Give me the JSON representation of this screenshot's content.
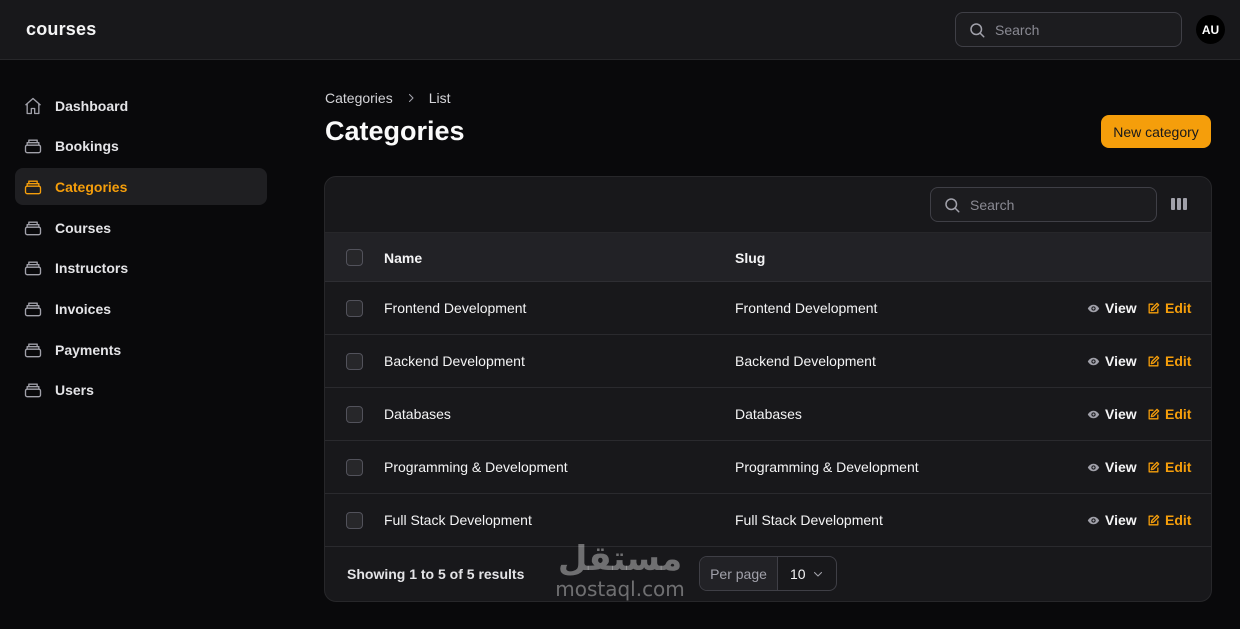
{
  "app": {
    "brand": "courses",
    "avatar_initials": "AU",
    "accent_color": "#f59e0b"
  },
  "header": {
    "search_placeholder": "Search"
  },
  "sidebar": {
    "items": [
      {
        "label": "Dashboard",
        "icon": "home-icon",
        "active": false
      },
      {
        "label": "Bookings",
        "icon": "stack-icon",
        "active": false
      },
      {
        "label": "Categories",
        "icon": "stack-icon",
        "active": true
      },
      {
        "label": "Courses",
        "icon": "stack-icon",
        "active": false
      },
      {
        "label": "Instructors",
        "icon": "stack-icon",
        "active": false
      },
      {
        "label": "Invoices",
        "icon": "stack-icon",
        "active": false
      },
      {
        "label": "Payments",
        "icon": "stack-icon",
        "active": false
      },
      {
        "label": "Users",
        "icon": "stack-icon",
        "active": false
      }
    ]
  },
  "breadcrumb": {
    "parent": "Categories",
    "current": "List"
  },
  "page": {
    "title": "Categories",
    "new_button": "New category"
  },
  "table": {
    "search_placeholder": "Search",
    "columns": {
      "name": "Name",
      "slug": "Slug"
    },
    "rows": [
      {
        "name": "Frontend Development",
        "slug": "Frontend Development"
      },
      {
        "name": "Backend Development",
        "slug": "Backend Development"
      },
      {
        "name": "Databases",
        "slug": "Databases"
      },
      {
        "name": "Programming & Development",
        "slug": "Programming & Development"
      },
      {
        "name": "Full Stack Development",
        "slug": "Full Stack Development"
      }
    ],
    "actions": {
      "view": "View",
      "edit": "Edit"
    },
    "footer": {
      "showing": "Showing 1 to 5 of 5 results",
      "per_page_label": "Per page",
      "per_page_value": "10"
    }
  },
  "watermark": {
    "arabic": "مستقل",
    "latin": "mostaql.com"
  }
}
